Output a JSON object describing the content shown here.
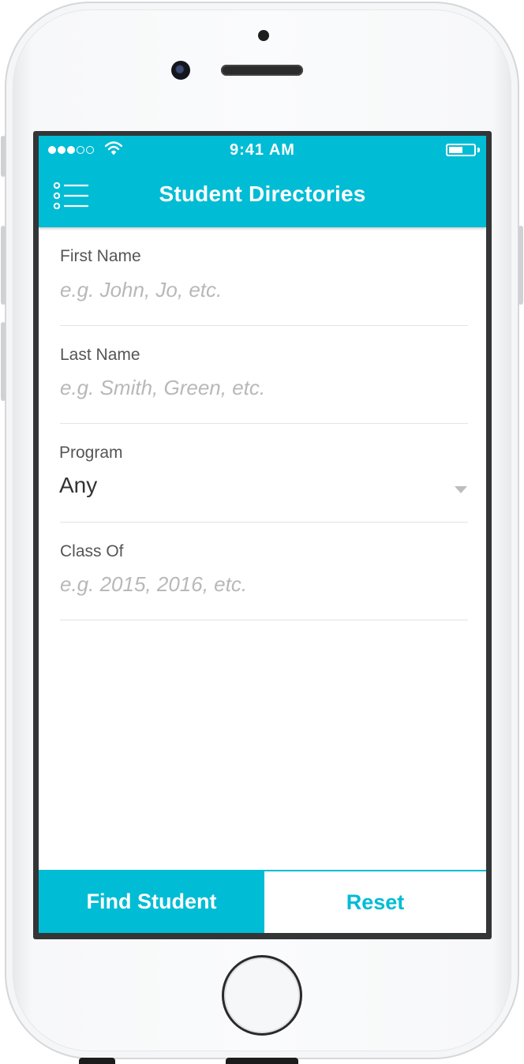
{
  "status_bar": {
    "time": "9:41 AM",
    "signal_bars_filled": 3,
    "signal_bars_total": 5,
    "battery_level": 0.55
  },
  "header": {
    "title": "Student Directories",
    "menu_icon": "list-menu-icon"
  },
  "form": {
    "first_name": {
      "label": "First Name",
      "placeholder": "e.g. John, Jo, etc.",
      "value": ""
    },
    "last_name": {
      "label": "Last Name",
      "placeholder": "e.g. Smith, Green, etc.",
      "value": ""
    },
    "program": {
      "label": "Program",
      "value": "Any"
    },
    "class_of": {
      "label": "Class Of",
      "placeholder": "e.g. 2015, 2016, etc.",
      "value": ""
    }
  },
  "actions": {
    "find_label": "Find Student",
    "reset_label": "Reset"
  },
  "colors": {
    "accent": "#00bcd4",
    "text": "#333333",
    "label": "#555555",
    "placeholder": "#b8b8b8"
  }
}
